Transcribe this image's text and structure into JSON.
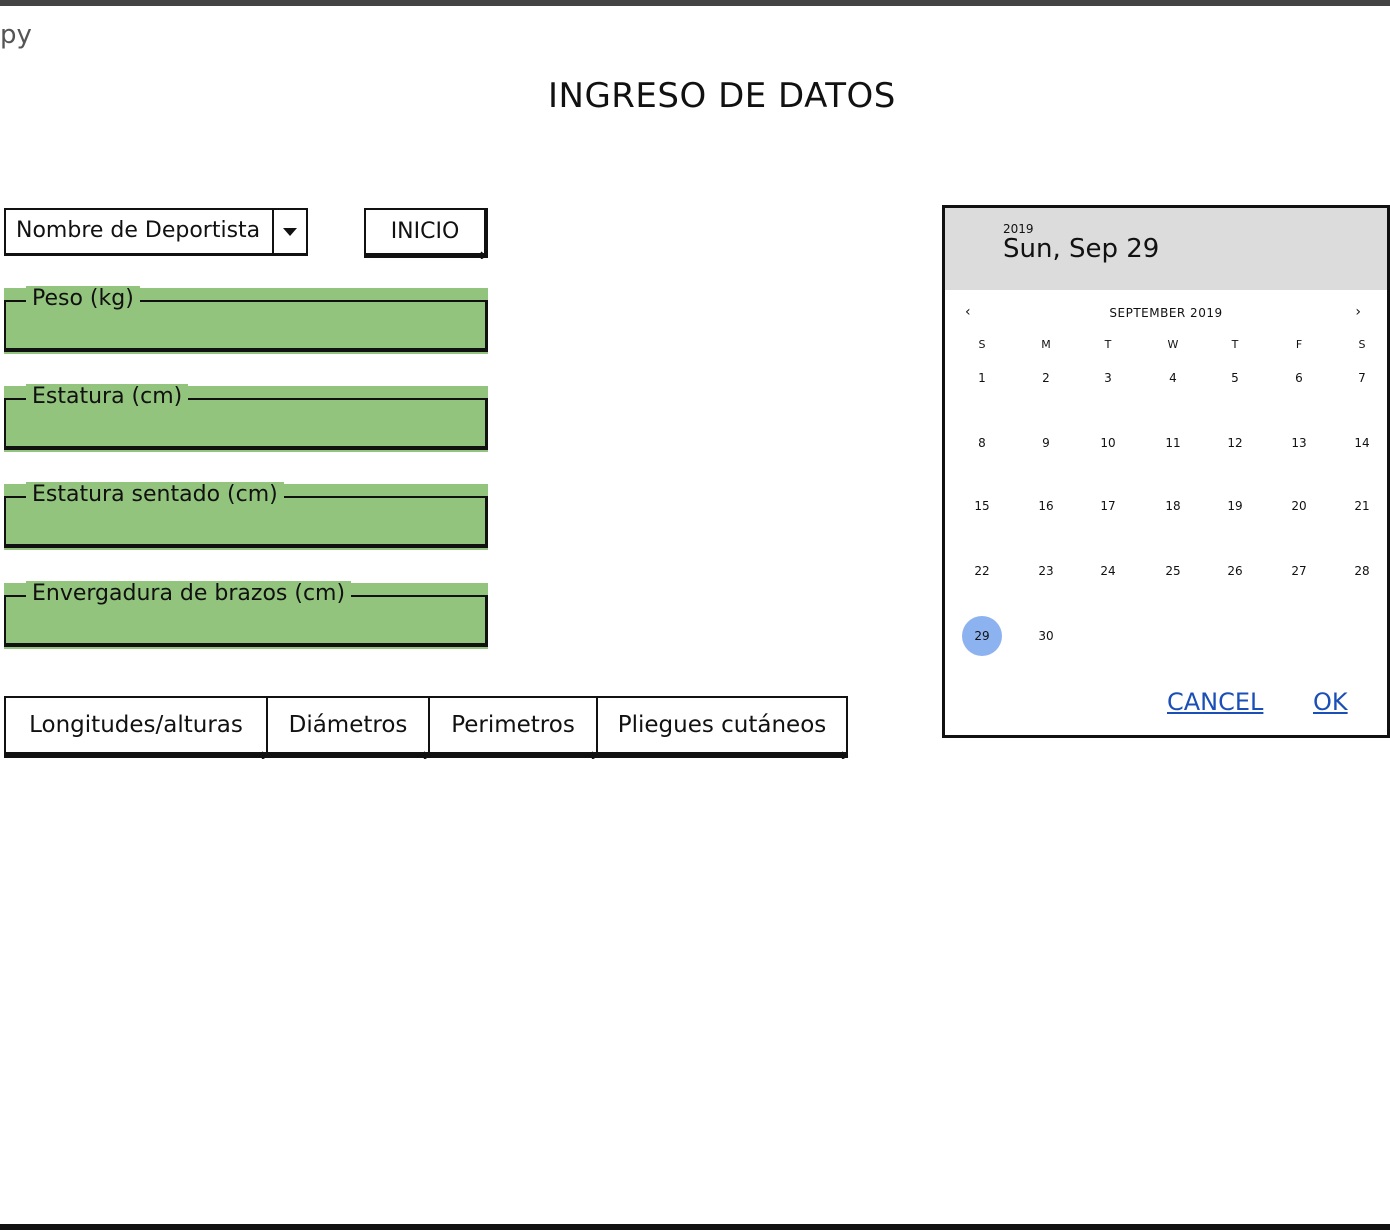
{
  "app": {
    "title_fragment": "py"
  },
  "page": {
    "title": "INGRESO DE DATOS"
  },
  "athlete_select": {
    "value": "Nombre de Deportista"
  },
  "start_button": {
    "label": "INICIO"
  },
  "fields": [
    {
      "label": "Peso (kg)",
      "value": ""
    },
    {
      "label": "Estatura (cm)",
      "value": ""
    },
    {
      "label": "Estatura sentado (cm)",
      "value": ""
    },
    {
      "label": "Envergadura de brazos (cm)",
      "value": ""
    }
  ],
  "tabs": [
    {
      "label": "Longitudes/alturas"
    },
    {
      "label": "Diámetros"
    },
    {
      "label": "Perimetros"
    },
    {
      "label": "Pliegues cutáneos"
    }
  ],
  "calendar": {
    "year": "2019",
    "selected_label": "Sun, Sep 29",
    "month_label": "SEPTEMBER 2019",
    "prev": "‹",
    "next": "›",
    "weekdays": [
      "S",
      "M",
      "T",
      "W",
      "T",
      "F",
      "S"
    ],
    "days": [
      "1",
      "2",
      "3",
      "4",
      "5",
      "6",
      "7",
      "8",
      "9",
      "10",
      "11",
      "12",
      "13",
      "14",
      "15",
      "16",
      "17",
      "18",
      "19",
      "20",
      "21",
      "22",
      "23",
      "24",
      "25",
      "26",
      "27",
      "28",
      "29",
      "30"
    ],
    "selected_day": 29,
    "cancel_label": "CANCEL",
    "ok_label": "OK",
    "accent_color": "#8db2f0",
    "link_color": "#1a4fb8"
  },
  "colors": {
    "field_fill": "#93c47d",
    "header_fill": "#dcdcdc"
  },
  "icons": {
    "dropdown": "caret-down-icon"
  }
}
